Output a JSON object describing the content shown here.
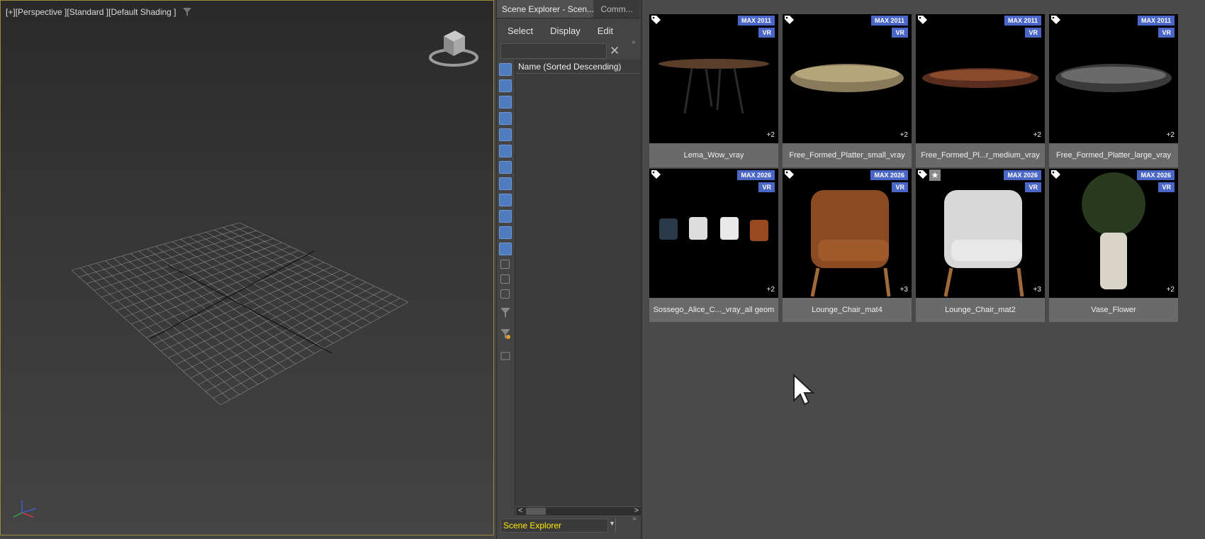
{
  "viewport": {
    "label_parts": [
      "[+]",
      "[Perspective ]",
      "[Standard ]",
      "[Default Shading ]"
    ],
    "filter_icon": "filter-icon"
  },
  "explorer": {
    "tabs": [
      "Scene Explorer - Scen...",
      "Comm..."
    ],
    "menu": [
      "Select",
      "Display",
      "Edit"
    ],
    "search_value": "",
    "column_header": "Name (Sorted Descending)",
    "footer_value": "Scene Explorer"
  },
  "assets": [
    {
      "name": "Lema_Wow_vray",
      "max": "MAX 2011",
      "vr": "VR",
      "count": "+2",
      "starred": false
    },
    {
      "name": "Free_Formed_Platter_small_vray",
      "max": "MAX 2011",
      "vr": "VR",
      "count": "+2",
      "starred": false
    },
    {
      "name": "Free_Formed_Pl...r_medium_vray",
      "max": "MAX 2011",
      "vr": "VR",
      "count": "+2",
      "starred": false
    },
    {
      "name": "Free_Formed_Platter_large_vray",
      "max": "MAX 2011",
      "vr": "VR",
      "count": "+2",
      "starred": false
    },
    {
      "name": "Sossego_Alice_C..._vray_all geom",
      "max": "MAX 2026",
      "vr": "VR",
      "count": "+2",
      "starred": false
    },
    {
      "name": "Lounge_Chair_mat4",
      "max": "MAX 2026",
      "vr": "VR",
      "count": "+3",
      "starred": false
    },
    {
      "name": "Lounge_Chair_mat2",
      "max": "MAX 2026",
      "vr": "VR",
      "count": "+3",
      "starred": true
    },
    {
      "name": "Vase_Flower",
      "max": "MAX 2026",
      "vr": "VR",
      "count": "+2",
      "starred": false
    }
  ],
  "colors": {
    "badge": "#4a67c8",
    "viewport_border": "#9a8a3a",
    "footer_text": "#ffea00"
  }
}
